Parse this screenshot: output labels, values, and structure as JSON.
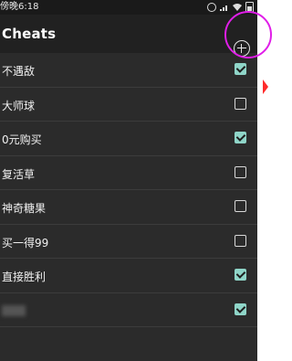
{
  "status": {
    "time": "傍晚6:18"
  },
  "appbar": {
    "title": "Cheats"
  },
  "cheats": [
    {
      "label": "不遇敌",
      "checked": true
    },
    {
      "label": "大师球",
      "checked": false
    },
    {
      "label": "0元购买",
      "checked": true
    },
    {
      "label": "复活草",
      "checked": false
    },
    {
      "label": "神奇糖果",
      "checked": false
    },
    {
      "label": "买一得99",
      "checked": false
    },
    {
      "label": "直接胜利",
      "checked": true
    },
    {
      "label": "",
      "checked": true
    }
  ],
  "colors": {
    "checkbox_checked": "#8fd5c8",
    "highlight_circle": "#e01ee8",
    "edge_marker": "#ff2b2b"
  },
  "icons": {
    "add": "plus-in-circle",
    "status": [
      "alarm-icon",
      "signal-icon",
      "wifi-icon",
      "battery-icon"
    ]
  }
}
